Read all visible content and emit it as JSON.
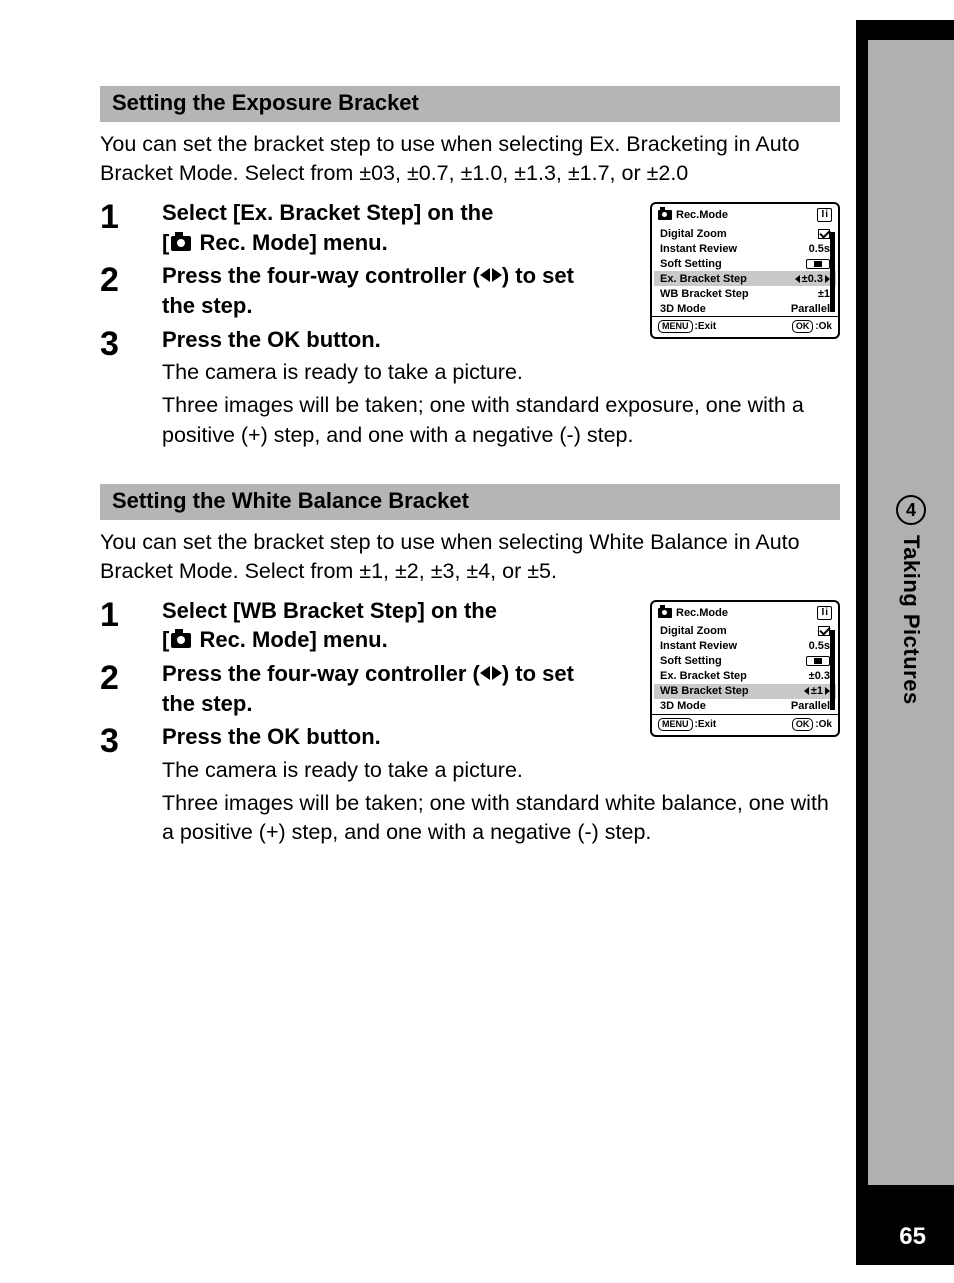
{
  "sideTab": {
    "chapter": "4",
    "title": "Taking Pictures"
  },
  "pageNumber": "65",
  "sections": [
    {
      "header": "Setting the Exposure Bracket",
      "intro": "You can set the bracket step to use when selecting Ex. Bracketing in Auto Bracket Mode. Select from ±03, ±0.7, ±1.0, ±1.3, ±1.7,  or ±2.0",
      "steps": [
        {
          "num": "1",
          "titleA": "Select [Ex. Bracket Step] on the",
          "titleB_prefix": "[",
          "titleB_suffix": " Rec. Mode] menu."
        },
        {
          "num": "2",
          "titleA": "Press the four-way controller (",
          "titleB": ") to set the step."
        },
        {
          "num": "3",
          "titleA": "Press the OK button.",
          "noteA": "The camera is ready to take a picture.",
          "noteB": "Three images will be taken; one with standard exposure, one with a positive (+) step, and one with a negative (-) step."
        }
      ],
      "lcd": {
        "title": "Rec.Mode",
        "rows": [
          {
            "label": "Digital Zoom",
            "valType": "check"
          },
          {
            "label": "Instant Review",
            "val": "0.5s"
          },
          {
            "label": "Soft Setting",
            "valType": "slider"
          },
          {
            "label": "Ex. Bracket Step",
            "val": "±0.3",
            "selected": true,
            "arrows": true
          },
          {
            "label": "WB Bracket Step",
            "val": "±1"
          },
          {
            "label": "3D Mode",
            "val": "Parallel"
          }
        ],
        "footer": {
          "left": "Exit",
          "leftPill": "MENU",
          "right": "Ok",
          "rightPill": "OK"
        }
      }
    },
    {
      "header": "Setting the White Balance Bracket",
      "intro": "You can set the bracket step to use when selecting White Balance in Auto Bracket Mode. Select from ±1, ±2, ±3, ±4, or ±5.",
      "steps": [
        {
          "num": "1",
          "titleA": "Select [WB Bracket Step] on the",
          "titleB_prefix": "[",
          "titleB_suffix": " Rec. Mode] menu."
        },
        {
          "num": "2",
          "titleA": "Press the four-way controller (",
          "titleB": ") to set the step."
        },
        {
          "num": "3",
          "titleA": "Press the OK button.",
          "noteA": "The camera is ready to take a picture.",
          "noteB": "Three images will be taken; one with standard white balance, one with a positive (+) step, and one with a negative (-) step."
        }
      ],
      "lcd": {
        "title": "Rec.Mode",
        "rows": [
          {
            "label": "Digital Zoom",
            "valType": "check"
          },
          {
            "label": "Instant Review",
            "val": "0.5s"
          },
          {
            "label": "Soft Setting",
            "valType": "slider"
          },
          {
            "label": "Ex. Bracket Step",
            "val": "±0.3"
          },
          {
            "label": "WB Bracket Step",
            "val": "±1",
            "selected": true,
            "arrows": true
          },
          {
            "label": "3D Mode",
            "val": "Parallel"
          }
        ],
        "footer": {
          "left": "Exit",
          "leftPill": "MENU",
          "right": "Ok",
          "rightPill": "OK"
        }
      }
    }
  ]
}
